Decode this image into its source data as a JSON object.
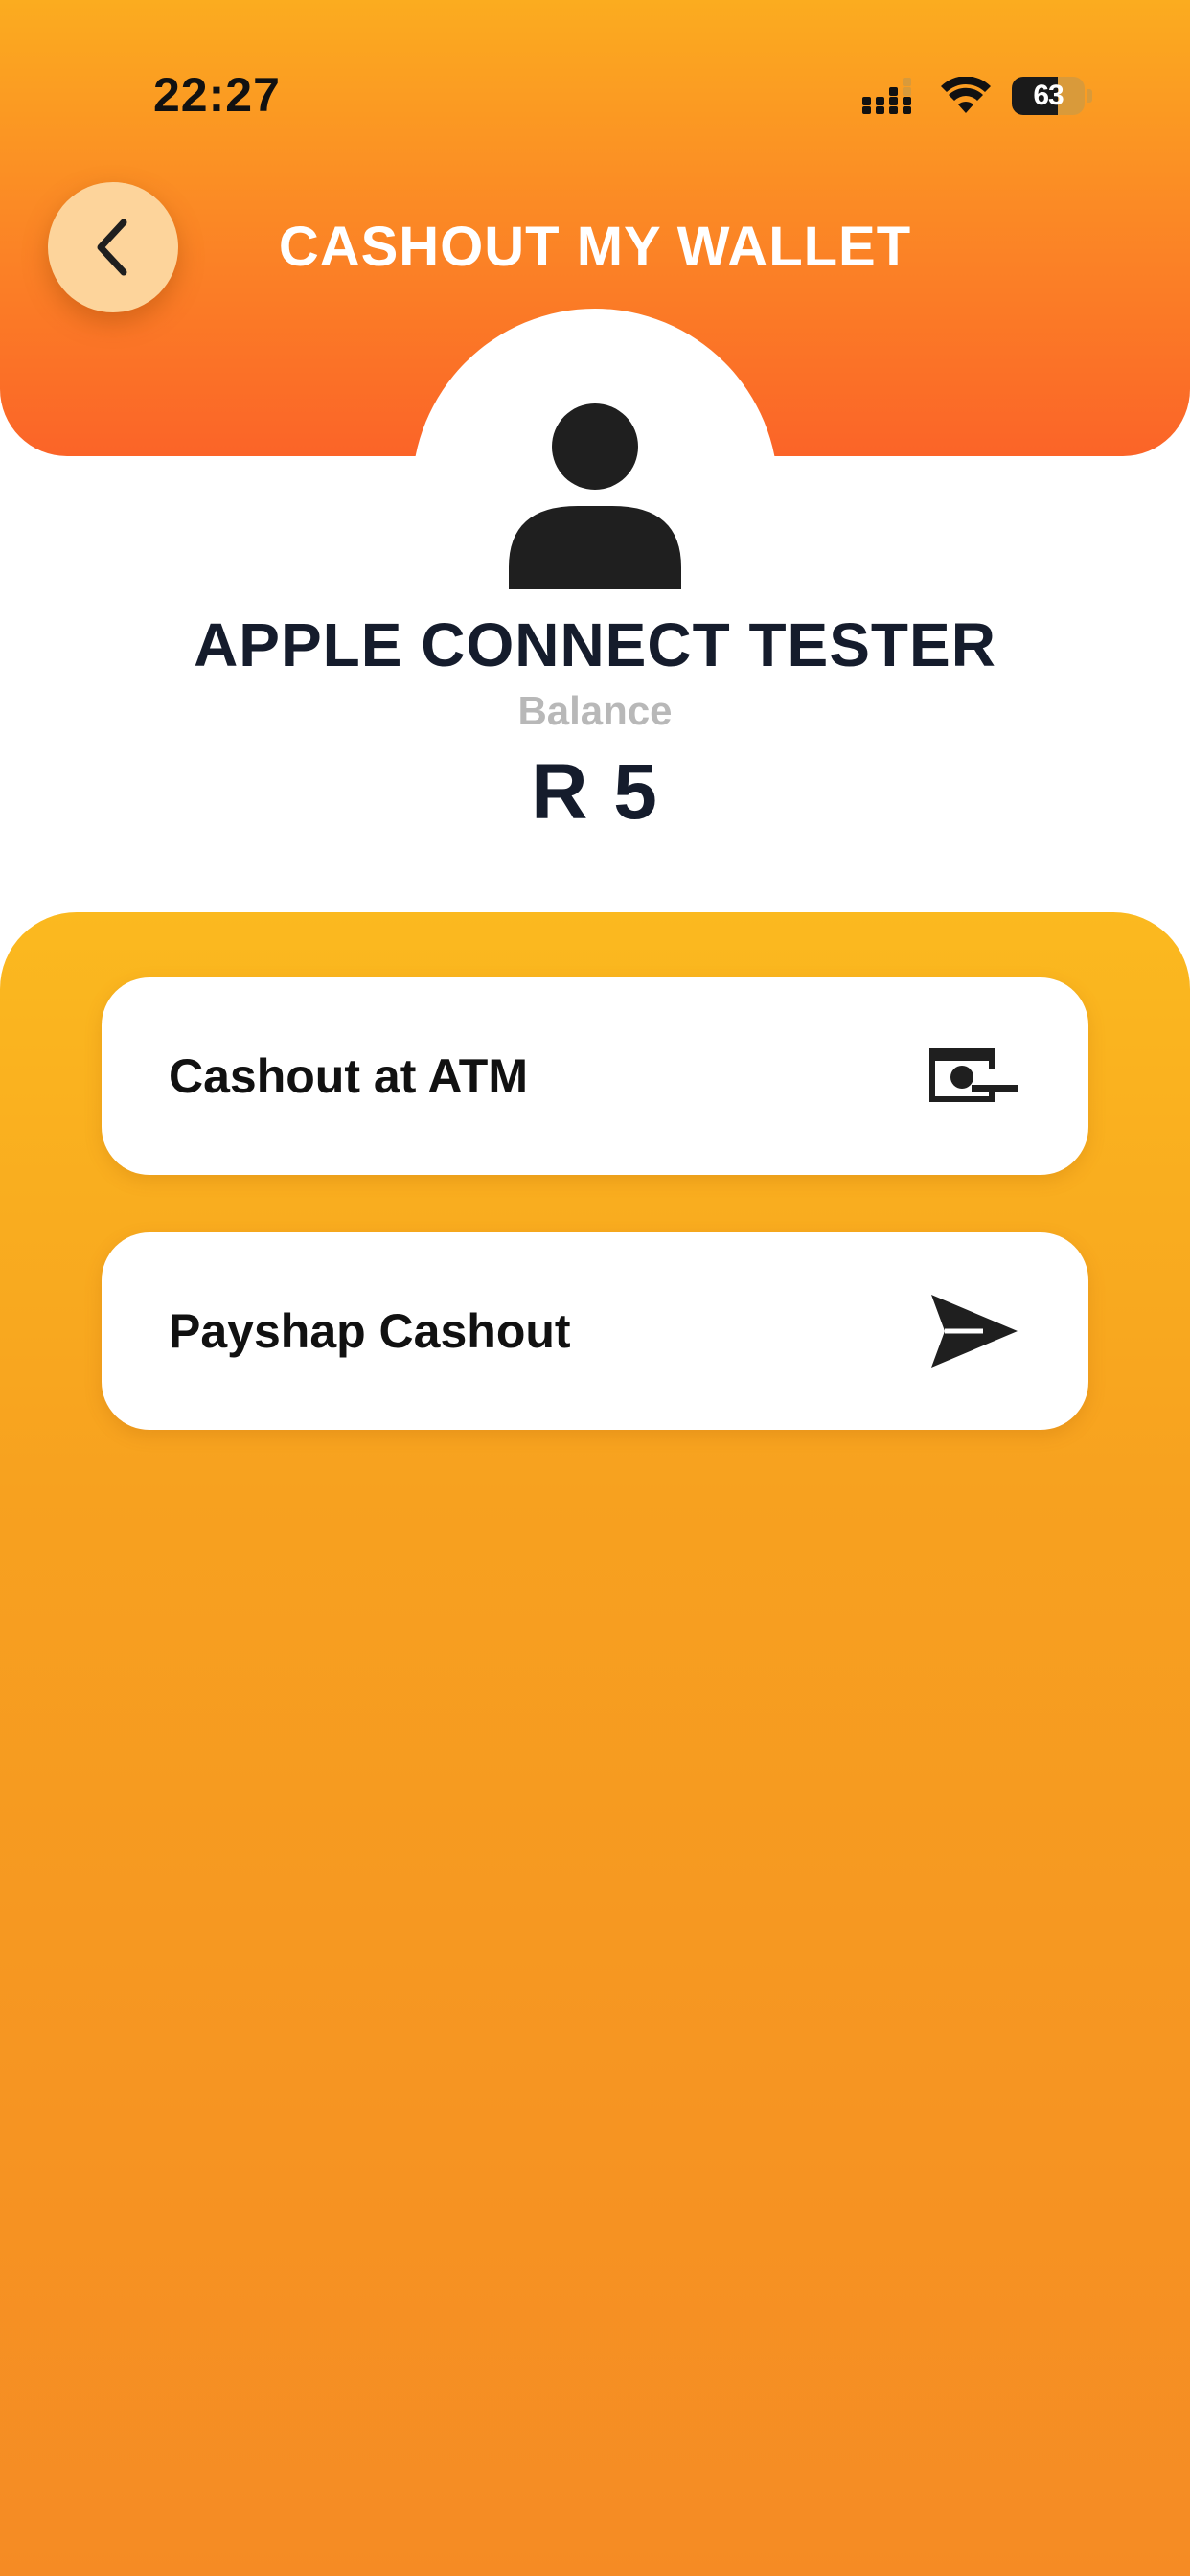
{
  "status_bar": {
    "time": "22:27",
    "battery_level": "63",
    "icons": [
      "cellular-signal-icon",
      "wifi-icon",
      "battery-icon"
    ]
  },
  "header": {
    "title": "CASHOUT MY WALLET",
    "back_icon": "chevron-left-icon"
  },
  "profile": {
    "avatar_icon": "user-avatar-icon",
    "name": "APPLE CONNECT TESTER",
    "balance_label": "Balance",
    "balance_value": "R 5"
  },
  "options": [
    {
      "label": "Cashout at ATM",
      "icon": "cash-withdraw-icon"
    },
    {
      "label": "Payshap Cashout",
      "icon": "send-icon"
    }
  ],
  "colors": {
    "header_gradient_top": "#fbac1f",
    "header_gradient_bottom": "#fb6428",
    "panel_gradient_top": "#fbb91f",
    "panel_gradient_bottom": "#f58b24",
    "back_button": "#fdd49b",
    "text_dark": "#151c2c",
    "muted_text": "#b8b8b8"
  }
}
